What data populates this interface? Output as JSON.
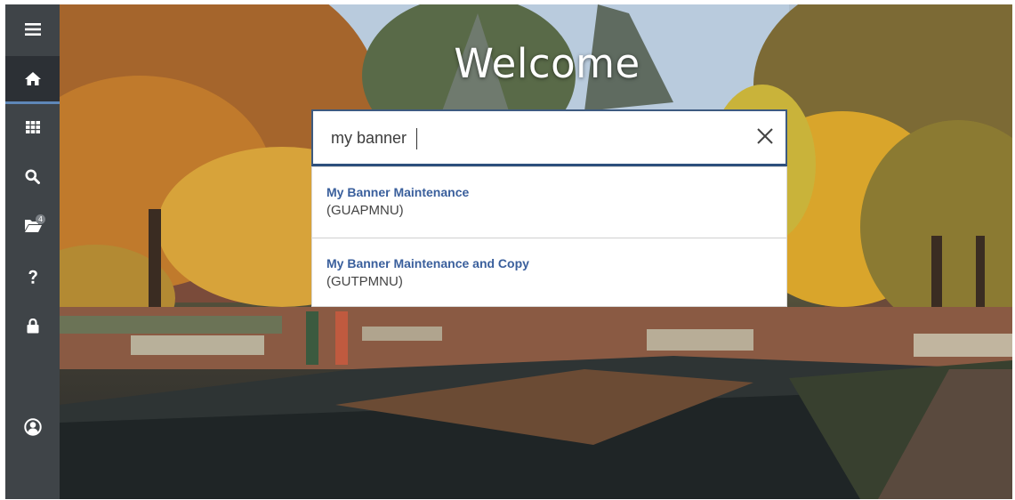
{
  "welcome": {
    "title": "Welcome"
  },
  "sidebar": {
    "items": [
      {
        "name": "menu",
        "icon": "hamburger-icon",
        "active": false
      },
      {
        "name": "home",
        "icon": "home-icon",
        "active": true
      },
      {
        "name": "applications",
        "icon": "grid-icon",
        "active": false
      },
      {
        "name": "search",
        "icon": "search-icon",
        "active": false
      },
      {
        "name": "recent",
        "icon": "folder-open-icon",
        "active": false,
        "badge": "4"
      },
      {
        "name": "help",
        "icon": "question-icon",
        "active": false
      },
      {
        "name": "lock",
        "icon": "lock-icon",
        "active": false
      },
      {
        "name": "user",
        "icon": "user-circle-icon",
        "active": false
      }
    ]
  },
  "search": {
    "value": "my banner",
    "clear_icon": "close-icon"
  },
  "results": [
    {
      "title": "My Banner Maintenance",
      "code": "(GUAPMNU)"
    },
    {
      "title": "My Banner Maintenance and Copy",
      "code": "(GUTPMNU)"
    }
  ],
  "colors": {
    "sidebar_bg": "#3f4448",
    "sidebar_active": "#2c3035",
    "accent": "#5e87b8",
    "result_title": "#3a5f9c",
    "search_border": "#2d4f7c"
  }
}
